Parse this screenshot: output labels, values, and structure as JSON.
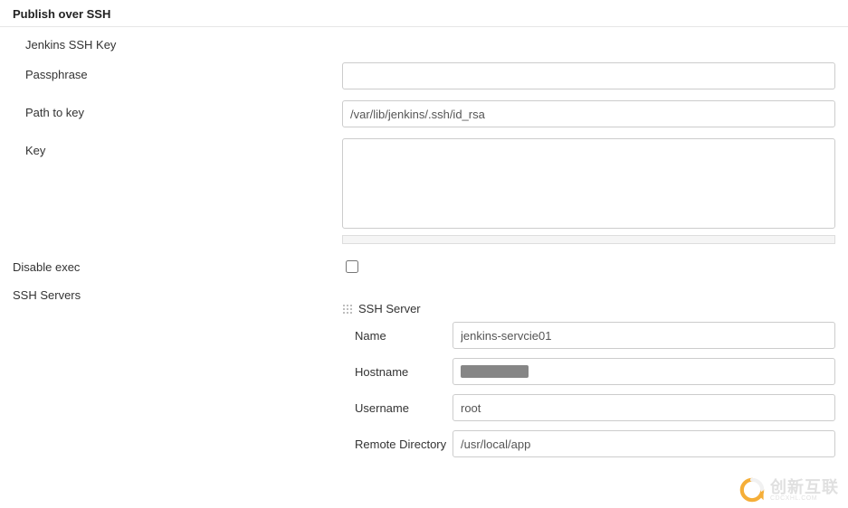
{
  "section": {
    "title": "Publish over SSH",
    "jenkins_key_heading": "Jenkins SSH Key",
    "passphrase_label": "Passphrase",
    "passphrase_value": "",
    "path_label": "Path to key",
    "path_value": "/var/lib/jenkins/.ssh/id_rsa",
    "key_label": "Key",
    "key_value": "",
    "disable_exec_label": "Disable exec",
    "disable_exec_checked": false,
    "ssh_servers_label": "SSH Servers",
    "ssh_server_subsection": "SSH Server",
    "server": {
      "name_label": "Name",
      "name_value": "jenkins-servcie01",
      "hostname_label": "Hostname",
      "hostname_value": "",
      "username_label": "Username",
      "username_value": "root",
      "remote_dir_label": "Remote Directory",
      "remote_dir_value": "/usr/local/app"
    }
  },
  "watermark": {
    "main": "创新互联",
    "sub": "CDCXHL.COM"
  }
}
